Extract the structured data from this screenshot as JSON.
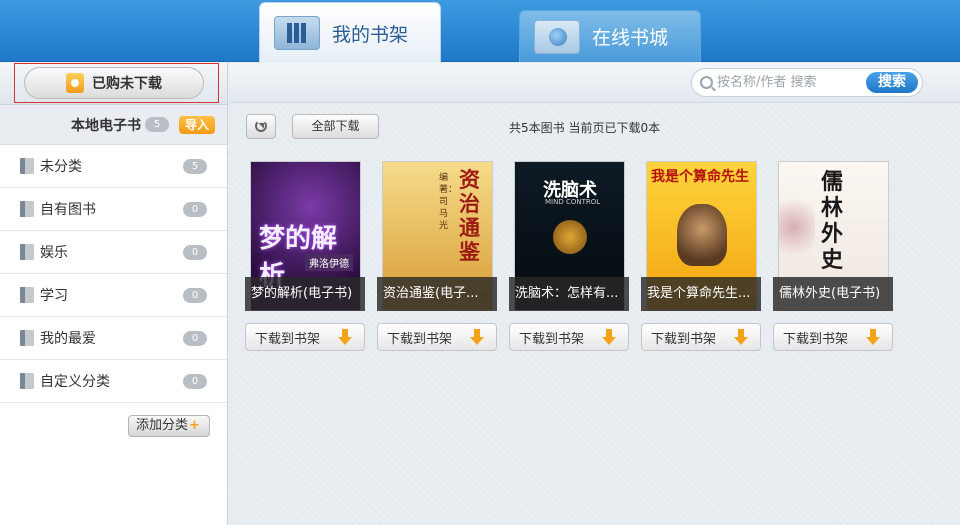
{
  "tabs": [
    {
      "label": "我的书架",
      "icon": "bookshelf-icon",
      "active": true
    },
    {
      "label": "在线书城",
      "icon": "globe-folder-icon",
      "active": false
    }
  ],
  "sidebar": {
    "purchased_label": "已购未下载",
    "local_label": "本地电子书",
    "local_count": "5",
    "import_label": "导入",
    "categories": [
      {
        "label": "未分类",
        "count": "5"
      },
      {
        "label": "自有图书",
        "count": "0"
      },
      {
        "label": "娱乐",
        "count": "0"
      },
      {
        "label": "学习",
        "count": "0"
      },
      {
        "label": "我的最爱",
        "count": "0"
      },
      {
        "label": "自定义分类",
        "count": "0"
      }
    ],
    "add_category_label": "添加分类"
  },
  "search": {
    "placeholder": "按名称/作者 搜索",
    "button_label": "搜索"
  },
  "toolbar": {
    "download_all_label": "全部下载",
    "summary": "共5本图书 当前页已下载0本"
  },
  "books": [
    {
      "caption": "梦的解析(电子书)",
      "cover_title": "梦的解析",
      "cover_author": "弗洛伊德",
      "download_label": "下载到书架"
    },
    {
      "caption": "资治通鉴(电子...",
      "cover_title": "资治通鉴",
      "cover_author": "编著：司马光",
      "download_label": "下载到书架"
    },
    {
      "caption": "洗脑术：怎样有...",
      "cover_title": "洗脑术",
      "cover_subtitle": "MIND CONTROL",
      "download_label": "下载到书架"
    },
    {
      "caption": "我是个算命先生...",
      "cover_title": "我是个算命先生",
      "download_label": "下载到书架"
    },
    {
      "caption": "儒林外史(电子书)",
      "cover_title": "儒林外史",
      "download_label": "下载到书架"
    }
  ],
  "colors": {
    "topbar": "#2a88d4",
    "accent_orange": "#f3a116",
    "highlight_outline": "#d9322f"
  }
}
